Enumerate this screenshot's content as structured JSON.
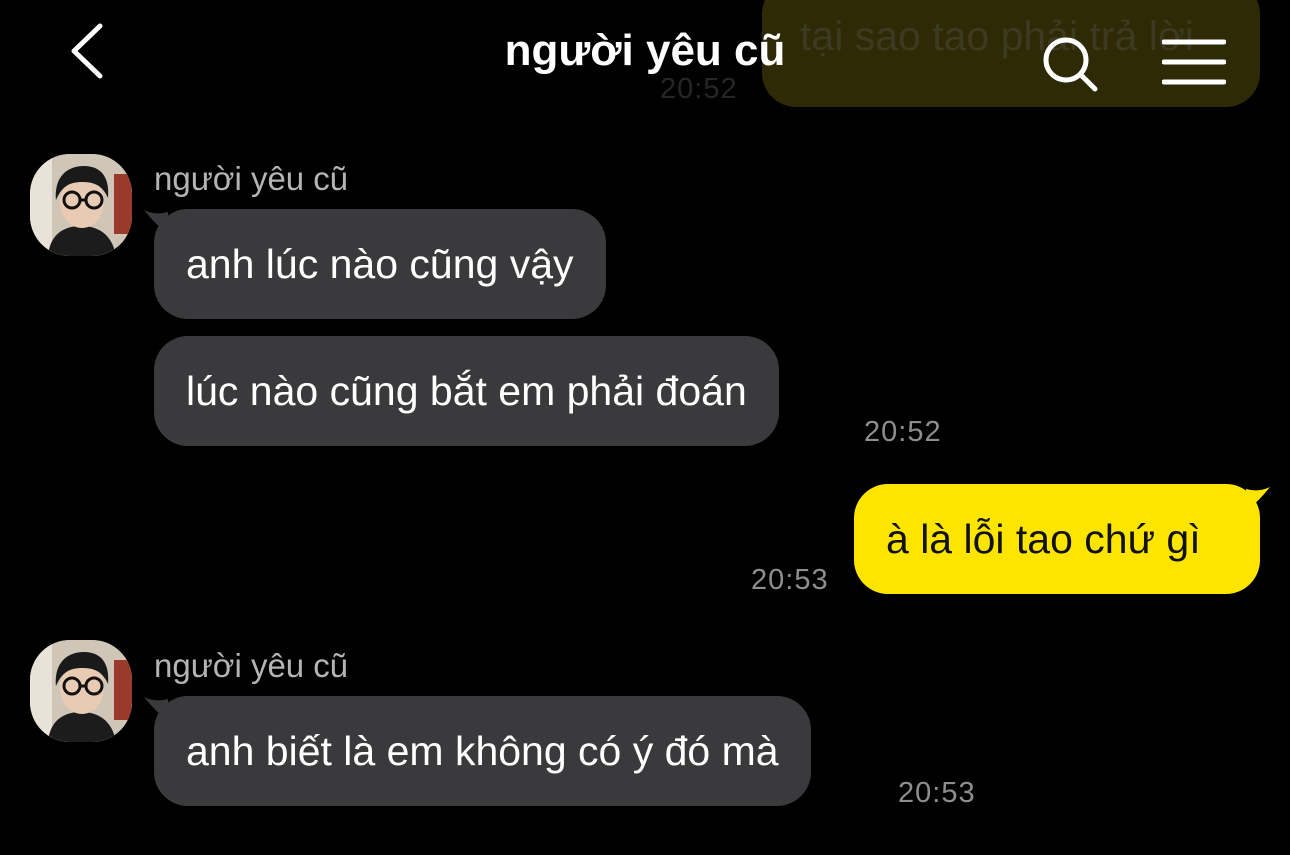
{
  "header": {
    "title": "người yêu cũ",
    "back_icon": "chevron-left-icon",
    "search_icon": "search-icon",
    "menu_icon": "hamburger-menu-icon"
  },
  "faded_message": {
    "text": "tại sao tao phải trả lời",
    "time": "20:52"
  },
  "messages": [
    {
      "sender": "người yêu cũ",
      "direction": "incoming",
      "text": "anh lúc nào cũng vậy"
    },
    {
      "direction": "incoming",
      "text": "lúc nào cũng bắt em phải đoán",
      "time": "20:52"
    },
    {
      "direction": "outgoing",
      "text": "à là lỗi tao chứ gì",
      "time": "20:53"
    },
    {
      "sender": "người yêu cũ",
      "direction": "incoming",
      "text": "anh biết là em không có ý đó mà",
      "time": "20:53"
    }
  ],
  "colors": {
    "background": "#000000",
    "incoming_bubble": "#3a3a3c",
    "outgoing_bubble": "#fde500",
    "timestamp": "#8e8e8e"
  }
}
